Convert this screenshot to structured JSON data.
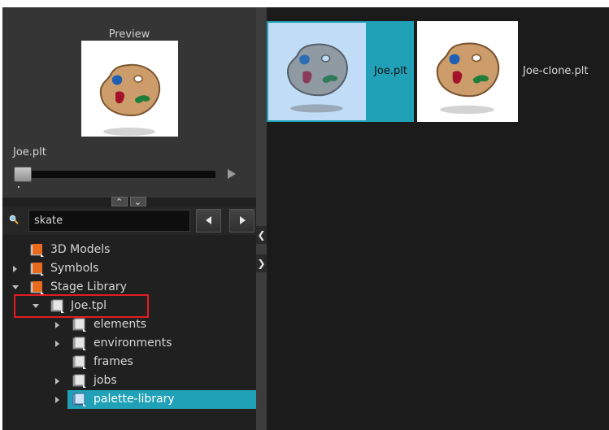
{
  "preview": {
    "title": "Preview",
    "name": "Joe.plt"
  },
  "search": {
    "value": "skate"
  },
  "tree": {
    "items": [
      {
        "label": "3D Models"
      },
      {
        "label": "Symbols"
      },
      {
        "label": "Stage Library"
      },
      {
        "label": "Joe.tpl"
      },
      {
        "label": "elements"
      },
      {
        "label": "environments"
      },
      {
        "label": "frames"
      },
      {
        "label": "jobs"
      },
      {
        "label": "palette-library"
      }
    ]
  },
  "thumbnails": [
    {
      "label": "Joe.plt",
      "selected": true
    },
    {
      "label": "Joe-clone.plt",
      "selected": false
    }
  ],
  "colors": {
    "accent": "#21a1b7",
    "highlight_box": "#e41b23",
    "selected_thumb_bg": "#c1dcf6"
  }
}
